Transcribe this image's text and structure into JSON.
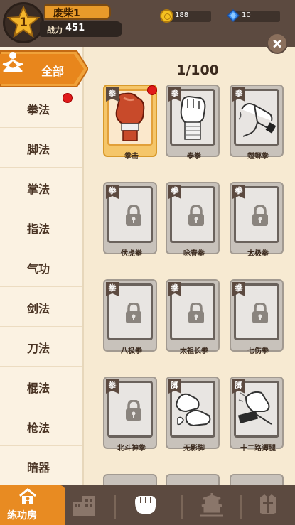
{
  "player": {
    "level": "1",
    "name": "废柴1",
    "power_label": "战力",
    "power_value": "451"
  },
  "currency": {
    "coins": "188",
    "gems": "10"
  },
  "progress": {
    "text": "1/100"
  },
  "nav": {
    "all_label": "全部",
    "items": [
      {
        "label": "拳法",
        "has_dot": true
      },
      {
        "label": "脚法"
      },
      {
        "label": "掌法"
      },
      {
        "label": "指法"
      },
      {
        "label": "气功"
      },
      {
        "label": "剑法"
      },
      {
        "label": "刀法"
      },
      {
        "label": "棍法"
      },
      {
        "label": "枪法"
      },
      {
        "label": "暗器"
      }
    ]
  },
  "cards": [
    {
      "tag": "拳",
      "name": "拳击",
      "art": "boxing-glove-icon",
      "state": "unlocked"
    },
    {
      "tag": "拳",
      "name": "泰拳",
      "art": "wrapped-fist-icon",
      "state": "preview"
    },
    {
      "tag": "拳",
      "name": "螳螂拳",
      "art": "mantis-hand-icon",
      "state": "preview"
    },
    {
      "tag": "拳",
      "name": "伏虎拳",
      "art": "lock-icon",
      "state": "locked"
    },
    {
      "tag": "拳",
      "name": "咏春拳",
      "art": "lock-icon",
      "state": "locked"
    },
    {
      "tag": "拳",
      "name": "太极拳",
      "art": "lock-icon",
      "state": "locked"
    },
    {
      "tag": "拳",
      "name": "八极拳",
      "art": "lock-icon",
      "state": "locked"
    },
    {
      "tag": "拳",
      "name": "太祖长拳",
      "art": "lock-icon",
      "state": "locked"
    },
    {
      "tag": "拳",
      "name": "七伤拳",
      "art": "lock-icon",
      "state": "locked"
    },
    {
      "tag": "拳",
      "name": "北斗神拳",
      "art": "lock-icon",
      "state": "locked"
    },
    {
      "tag": "脚",
      "name": "无影脚",
      "art": "bare-feet-icon",
      "state": "preview"
    },
    {
      "tag": "脚",
      "name": "十二路谭腿",
      "art": "wrapped-foot-icon",
      "state": "preview"
    }
  ],
  "bottom_nav": {
    "active_label": "练功房",
    "tabs": [
      "training-hall-icon",
      "buildings-icon",
      "fist-icon",
      "pagoda-icon",
      "armor-icon"
    ]
  },
  "colors": {
    "accent": "#e88b22",
    "dark": "#5c4a40",
    "background": "#f7ead2",
    "badge": "#e01a1a"
  }
}
